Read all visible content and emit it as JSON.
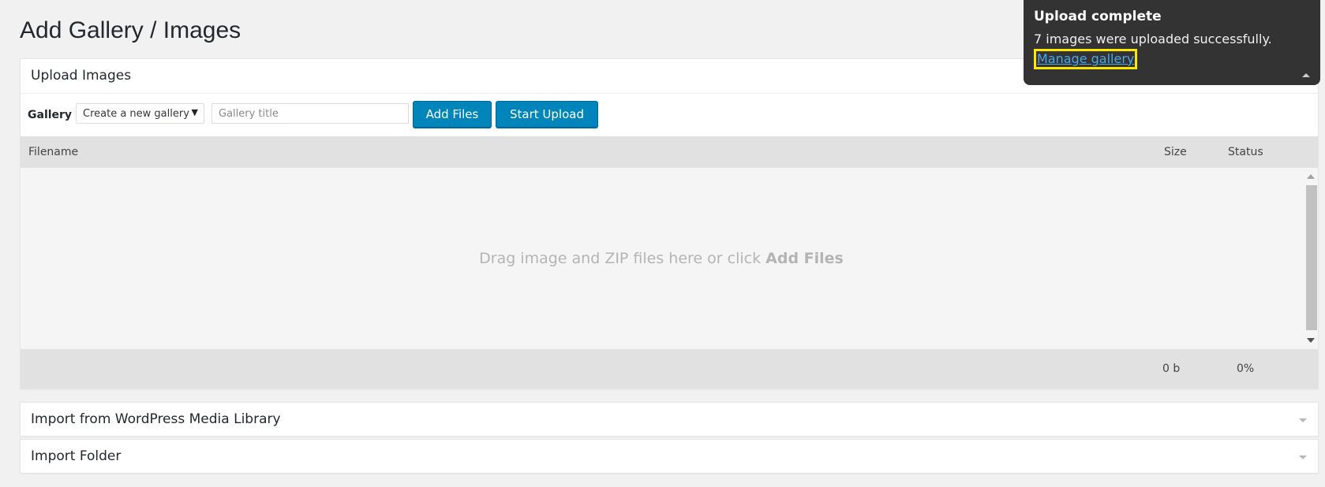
{
  "page": {
    "title": "Add Gallery / Images"
  },
  "upload": {
    "header": "Upload Images",
    "gallery_label": "Gallery",
    "gallery_select_value": "Create a new gallery",
    "gallery_title_placeholder": "Gallery title",
    "add_files_label": "Add Files",
    "start_upload_label": "Start Upload",
    "columns": {
      "filename": "Filename",
      "size": "Size",
      "status": "Status"
    },
    "drop_text": "Drag image and ZIP files here or click",
    "drop_text_bold": "Add Files",
    "footer": {
      "size": "0 b",
      "status": "0%"
    }
  },
  "import_media": {
    "header": "Import from WordPress Media Library"
  },
  "import_folder": {
    "header": "Import Folder"
  },
  "toast": {
    "title": "Upload complete",
    "message": "7 images were uploaded successfully.",
    "link": "Manage gallery"
  },
  "colors": {
    "primary_button": "#0085ba",
    "toast_bg": "#333333",
    "highlight": "#ffe800",
    "link": "#4aa8e8"
  }
}
